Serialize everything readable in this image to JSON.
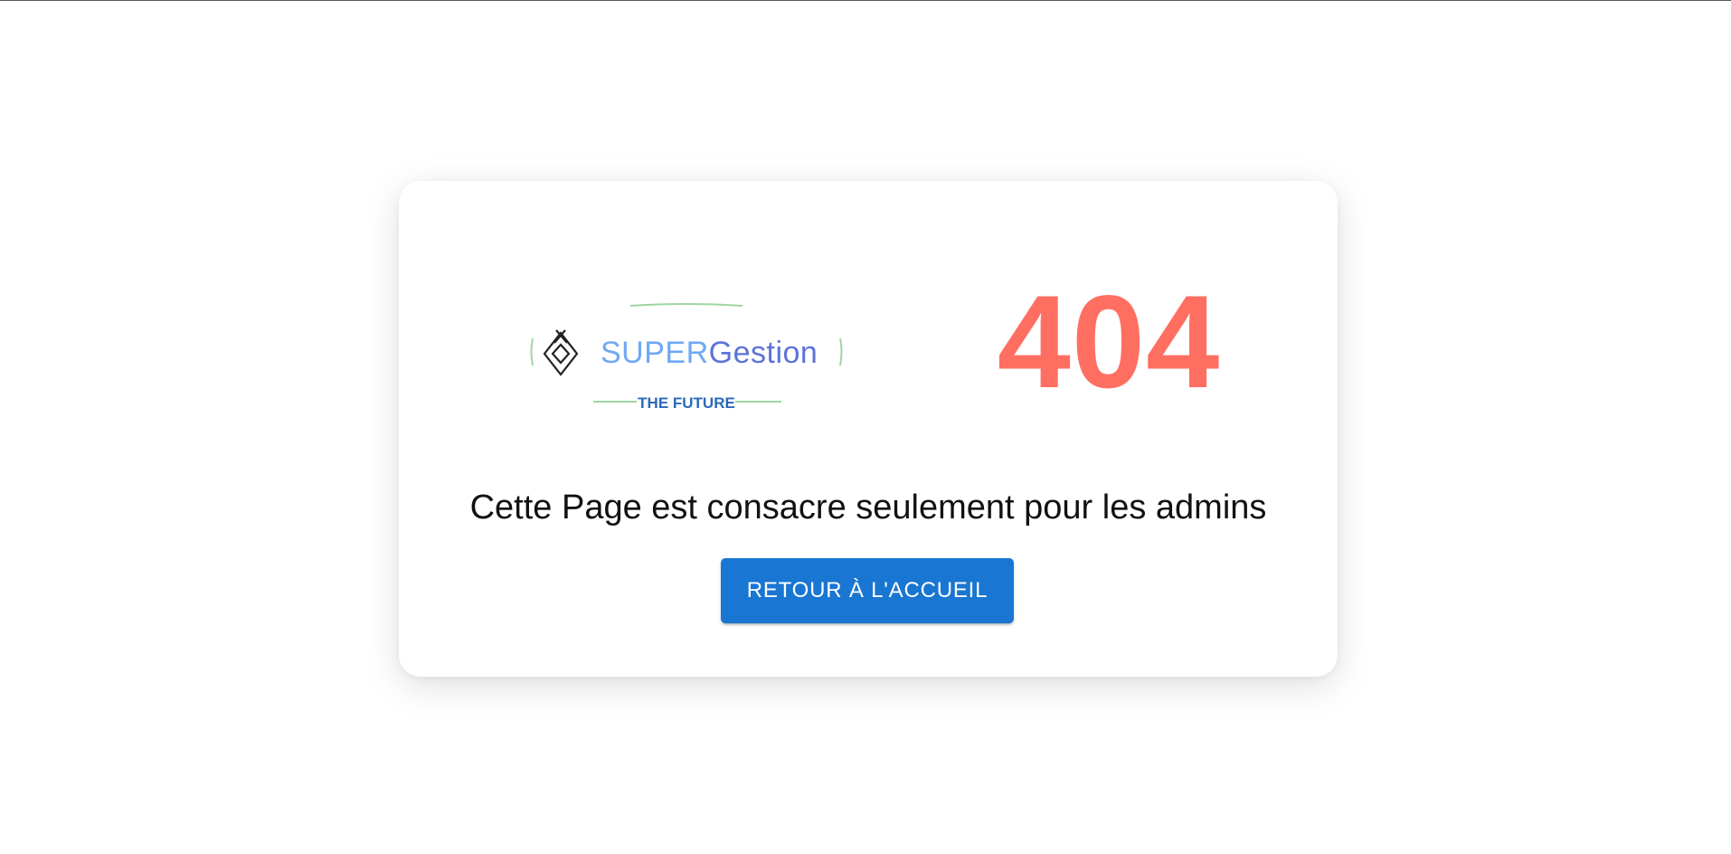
{
  "logo": {
    "brand_prefix": "SUPER",
    "brand_suffix": "Gestion",
    "tagline": "THE FUTURE",
    "icon": "diamond-logo-icon",
    "colors": {
      "prefix": "#6fa8f5",
      "suffix": "#5d73d8",
      "tagline": "#2b69b8",
      "accent_lines": "#9fd6a0"
    }
  },
  "error": {
    "code": "404",
    "color": "#ff6f61"
  },
  "message": "Cette Page est consacre seulement pour les admins",
  "button": {
    "label": "RETOUR À L'ACCUEIL",
    "color": "#1976d2"
  }
}
